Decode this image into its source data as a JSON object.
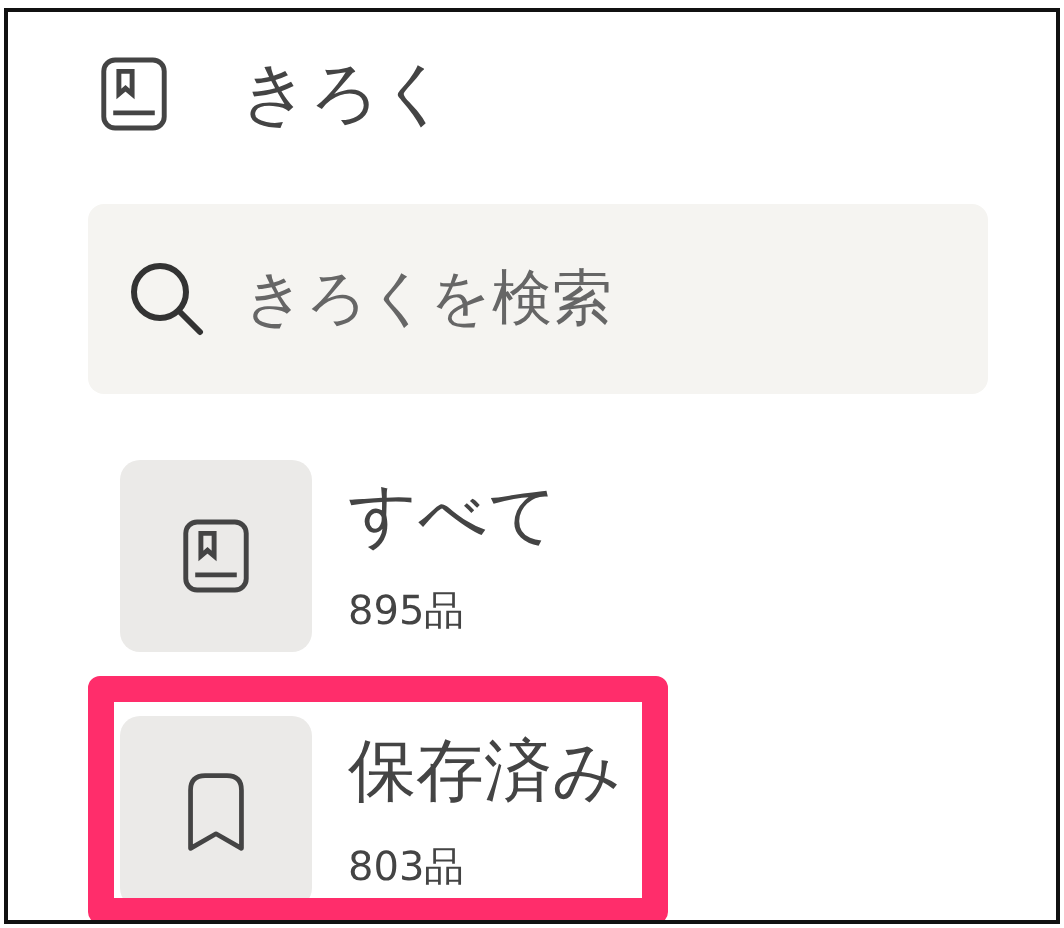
{
  "header": {
    "title": "きろく"
  },
  "search": {
    "placeholder": "きろくを検索"
  },
  "lists": [
    {
      "kind": "book",
      "title": "すべて",
      "count": "895品",
      "highlighted": false
    },
    {
      "kind": "bookmark",
      "title": "保存済み",
      "count": "803品",
      "highlighted": true
    }
  ]
}
